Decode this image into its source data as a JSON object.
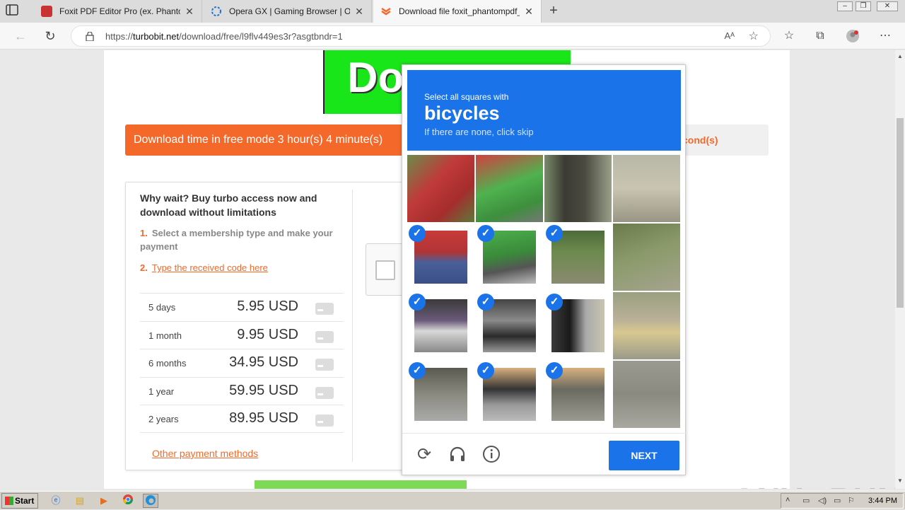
{
  "browser": {
    "tabs": [
      {
        "title": "Foxit PDF Editor Pro (ex. Phantom",
        "icon": "foxit-favicon",
        "color": "#c83232"
      },
      {
        "title": "Opera GX | Gaming Browser | Op",
        "icon": "opera-gx-favicon",
        "color": "#1e6fd9"
      },
      {
        "title": "Download file foxit_phantompdf_",
        "icon": "turbobit-favicon",
        "color": "#f4692a"
      }
    ],
    "new_tab": "+",
    "url_prefix": "https://",
    "url_domain": "turbobit.net",
    "url_path": "/download/free/l9flv449es3r?asgtbndr=1",
    "read_aloud": "Aᴬ"
  },
  "page": {
    "banner_text": "Do",
    "countdown_text": "Download time in free mode 3 hour(s) 4 minute(s)",
    "countdown_suffix": "cond(s)",
    "promo": {
      "heading": "Why wait? Buy turbo access now and download without limitations",
      "step1_num": "1.",
      "step1_text": "Select a membership type and make your payment",
      "step2_num": "2.",
      "step2_link": "Type the received code here",
      "prices": [
        {
          "period": "5 days",
          "price": "5.95 USD"
        },
        {
          "period": "1 month",
          "price": "9.95 USD"
        },
        {
          "period": "6 months",
          "price": "34.95 USD"
        },
        {
          "period": "1 year",
          "price": "59.95 USD"
        },
        {
          "period": "2 years",
          "price": "89.95 USD"
        }
      ],
      "other_methods": "Other payment methods"
    }
  },
  "captcha": {
    "instruction": "Select all squares with",
    "target": "bicycles",
    "hint": "If there are none, click skip",
    "tiles": [
      {
        "selected": false,
        "tone": "red-shirt"
      },
      {
        "selected": false,
        "tone": "green-backpack"
      },
      {
        "selected": false,
        "tone": "tree-trunk"
      },
      {
        "selected": false,
        "tone": "pavement"
      },
      {
        "selected": true,
        "tone": "jeans"
      },
      {
        "selected": true,
        "tone": "backpack-bike"
      },
      {
        "selected": true,
        "tone": "grass"
      },
      {
        "selected": false,
        "tone": "shade"
      },
      {
        "selected": true,
        "tone": "wheel"
      },
      {
        "selected": true,
        "tone": "engine"
      },
      {
        "selected": true,
        "tone": "tire"
      },
      {
        "selected": false,
        "tone": "curb"
      },
      {
        "selected": true,
        "tone": "road"
      },
      {
        "selected": true,
        "tone": "wheel-lower"
      },
      {
        "selected": true,
        "tone": "road-shadow"
      },
      {
        "selected": false,
        "tone": "asphalt"
      }
    ],
    "check_mark": "✓",
    "next_label": "NEXT",
    "accent": "#1a73e8"
  },
  "watermark": "ANY▷RUN",
  "taskbar": {
    "start_label": "Start",
    "clock": "3:44 PM"
  }
}
